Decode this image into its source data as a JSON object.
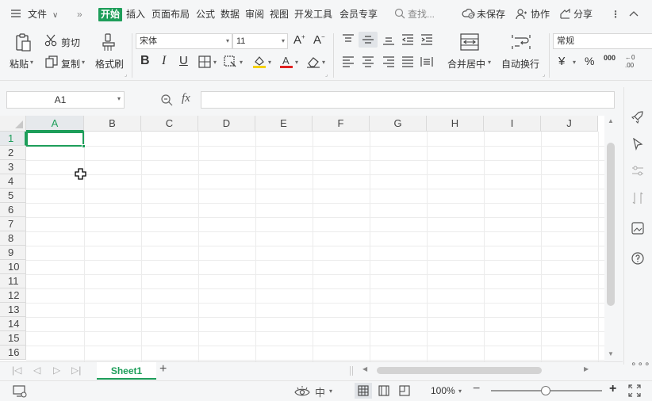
{
  "menubar": {
    "items": [
      {
        "label": "文件"
      },
      {
        "label": "开始"
      },
      {
        "label": "插入"
      },
      {
        "label": "页面布局"
      },
      {
        "label": "公式"
      },
      {
        "label": "数据"
      },
      {
        "label": "审阅"
      },
      {
        "label": "视图"
      },
      {
        "label": "开发工具"
      },
      {
        "label": "会员专享"
      }
    ],
    "search_label": "查找...",
    "unsaved_label": "未保存",
    "collab_label": "协作",
    "share_label": "分享"
  },
  "ribbon": {
    "paste_label": "粘贴",
    "cut_label": "剪切",
    "copy_label": "复制",
    "format_painter_label": "格式刷",
    "font_name": "宋体",
    "font_size": "11",
    "merge_label": "合并居中",
    "wrap_label": "自动换行",
    "number_format": "常规",
    "currency_glyph": "¥",
    "percent_glyph": "%",
    "thousands_glyph": "000"
  },
  "formula_bar": {
    "cell_ref": "A1",
    "fx_label": "fx",
    "formula_value": ""
  },
  "grid": {
    "columns": [
      "A",
      "B",
      "C",
      "D",
      "E",
      "F",
      "G",
      "H",
      "I",
      "J"
    ],
    "rows": [
      "1",
      "2",
      "3",
      "4",
      "5",
      "6",
      "7",
      "8",
      "9",
      "10",
      "11",
      "12",
      "13",
      "14",
      "15",
      "16"
    ],
    "active_cell": "A1",
    "accent_color": "#1e9e5a"
  },
  "sheets": {
    "tabs": [
      {
        "label": "Sheet1"
      }
    ],
    "add_label": "+"
  },
  "status": {
    "zoom_label": "100%"
  }
}
